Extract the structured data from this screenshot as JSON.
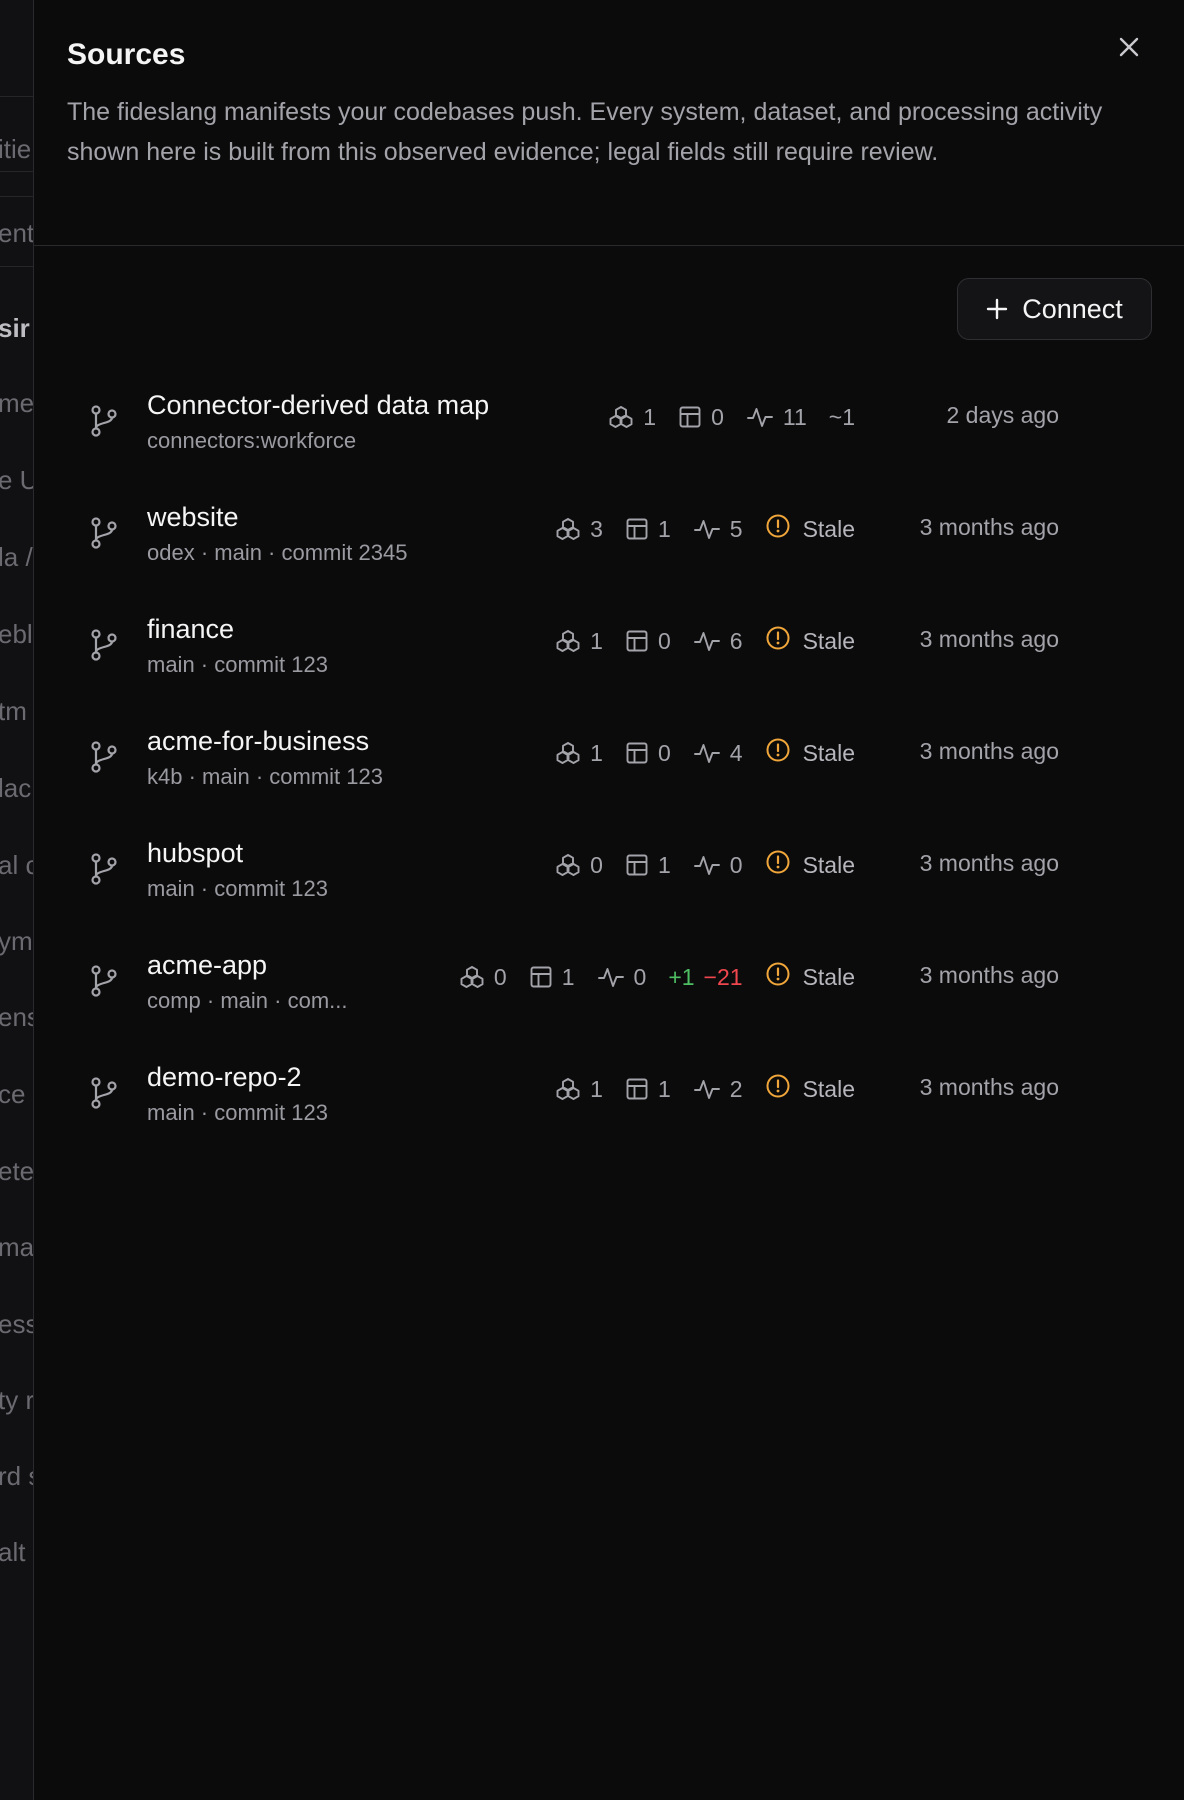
{
  "background_page": {
    "fragments": [
      {
        "text": "itie",
        "bold": false
      },
      {
        "text": "ent",
        "bold": false
      },
      {
        "text": "sir",
        "bold": true
      },
      {
        "text": "me",
        "bold": false
      },
      {
        "text": "e U",
        "bold": false
      },
      {
        "text": "la /",
        "bold": false
      },
      {
        "text": "ebl",
        "bold": false
      },
      {
        "text": "tm",
        "bold": false
      },
      {
        "text": "lac",
        "bold": false
      },
      {
        "text": "al c",
        "bold": false
      },
      {
        "text": "ym",
        "bold": false
      },
      {
        "text": "ens",
        "bold": false
      },
      {
        "text": "ce",
        "bold": false
      },
      {
        "text": "ete",
        "bold": false
      },
      {
        "text": "ma",
        "bold": false
      },
      {
        "text": "ess",
        "bold": false
      },
      {
        "text": "ty r",
        "bold": false
      },
      {
        "text": "rd s",
        "bold": false
      },
      {
        "text": "alt",
        "bold": false
      }
    ]
  },
  "sheet": {
    "title": "Sources",
    "description": "The fideslang manifests your codebases push. Every system, dataset, and processing activity shown here is built from this observed evidence; legal fields still require review.",
    "close_icon": "close-icon",
    "connect_label": "Connect"
  },
  "colors": {
    "stale_warning": "#f0a63a",
    "positive": "#4fbf63",
    "negative": "#f0474f"
  },
  "sources": [
    {
      "name": "Connector-derived data map",
      "meta": "connectors:workforce",
      "systems": "1",
      "datasets": "0",
      "activities": "11",
      "changed": "~1",
      "added": "",
      "removed": "",
      "stale": "",
      "time": "2 days ago"
    },
    {
      "name": "website",
      "meta": "odex · main · commit 2345",
      "systems": "3",
      "datasets": "1",
      "activities": "5",
      "changed": "",
      "added": "",
      "removed": "",
      "stale": "Stale",
      "time": "3 months ago"
    },
    {
      "name": "finance",
      "meta": "main · commit 123",
      "systems": "1",
      "datasets": "0",
      "activities": "6",
      "changed": "",
      "added": "",
      "removed": "",
      "stale": "Stale",
      "time": "3 months ago"
    },
    {
      "name": "acme-for-business",
      "meta": "k4b · main · commit 123",
      "systems": "1",
      "datasets": "0",
      "activities": "4",
      "changed": "",
      "added": "",
      "removed": "",
      "stale": "Stale",
      "time": "3 months ago"
    },
    {
      "name": "hubspot",
      "meta": "main · commit 123",
      "systems": "0",
      "datasets": "1",
      "activities": "0",
      "changed": "",
      "added": "",
      "removed": "",
      "stale": "Stale",
      "time": "3 months ago"
    },
    {
      "name": "acme-app",
      "meta": "comp · main · com...",
      "systems": "0",
      "datasets": "1",
      "activities": "0",
      "changed": "",
      "added": "+1",
      "removed": "−21",
      "stale": "Stale",
      "time": "3 months ago"
    },
    {
      "name": "demo-repo-2",
      "meta": "main · commit 123",
      "systems": "1",
      "datasets": "1",
      "activities": "2",
      "changed": "",
      "added": "",
      "removed": "",
      "stale": "Stale",
      "time": "3 months ago"
    }
  ]
}
